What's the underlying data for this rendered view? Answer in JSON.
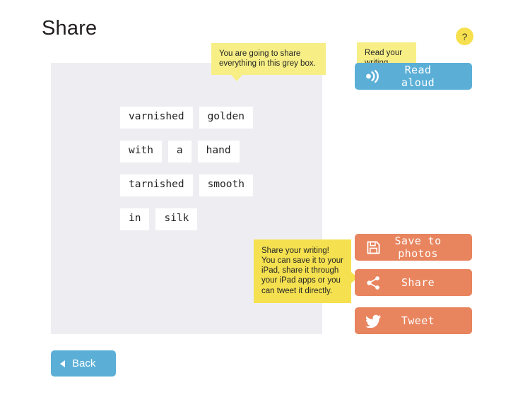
{
  "page": {
    "title": "Share"
  },
  "help": {
    "label": "?",
    "icon": "question-mark-icon",
    "color": "#f7e04f"
  },
  "writing_box": {
    "background": "#eeeef2",
    "rows": [
      {
        "words": [
          "varnished",
          "golden"
        ]
      },
      {
        "words": [
          "with",
          "a",
          "hand"
        ]
      },
      {
        "words": [
          "tarnished",
          "smooth"
        ]
      },
      {
        "words": [
          "in",
          "silk"
        ]
      }
    ]
  },
  "tooltips": {
    "grey_box": {
      "text": "You are going to share everything in this grey box.",
      "color": "#f7ef85",
      "pointer": "down"
    },
    "read_aloud": {
      "text": "Read your writing aloud.",
      "color": "#f7ef85",
      "pointer": "none"
    },
    "share": {
      "text": "Share your writing! You can save it to your iPad, share it through your iPad apps or you can tweet it directly.",
      "color": "#f5e14f",
      "pointer": "right"
    }
  },
  "buttons": {
    "read_aloud": {
      "label": "Read aloud",
      "icon": "volume-sound-icon",
      "color": "#5bafd7"
    },
    "save_to_photos": {
      "label": "Save to photos",
      "icon": "floppy-disk-save-icon",
      "color": "#e8845e"
    },
    "share": {
      "label": "Share",
      "icon": "share-nodes-icon",
      "color": "#e8845e"
    },
    "tweet": {
      "label": "Tweet",
      "icon": "twitter-bird-icon",
      "color": "#e8845e"
    },
    "back": {
      "label": "Back",
      "icon": "left-triangle-icon",
      "color": "#5bafd7"
    }
  }
}
